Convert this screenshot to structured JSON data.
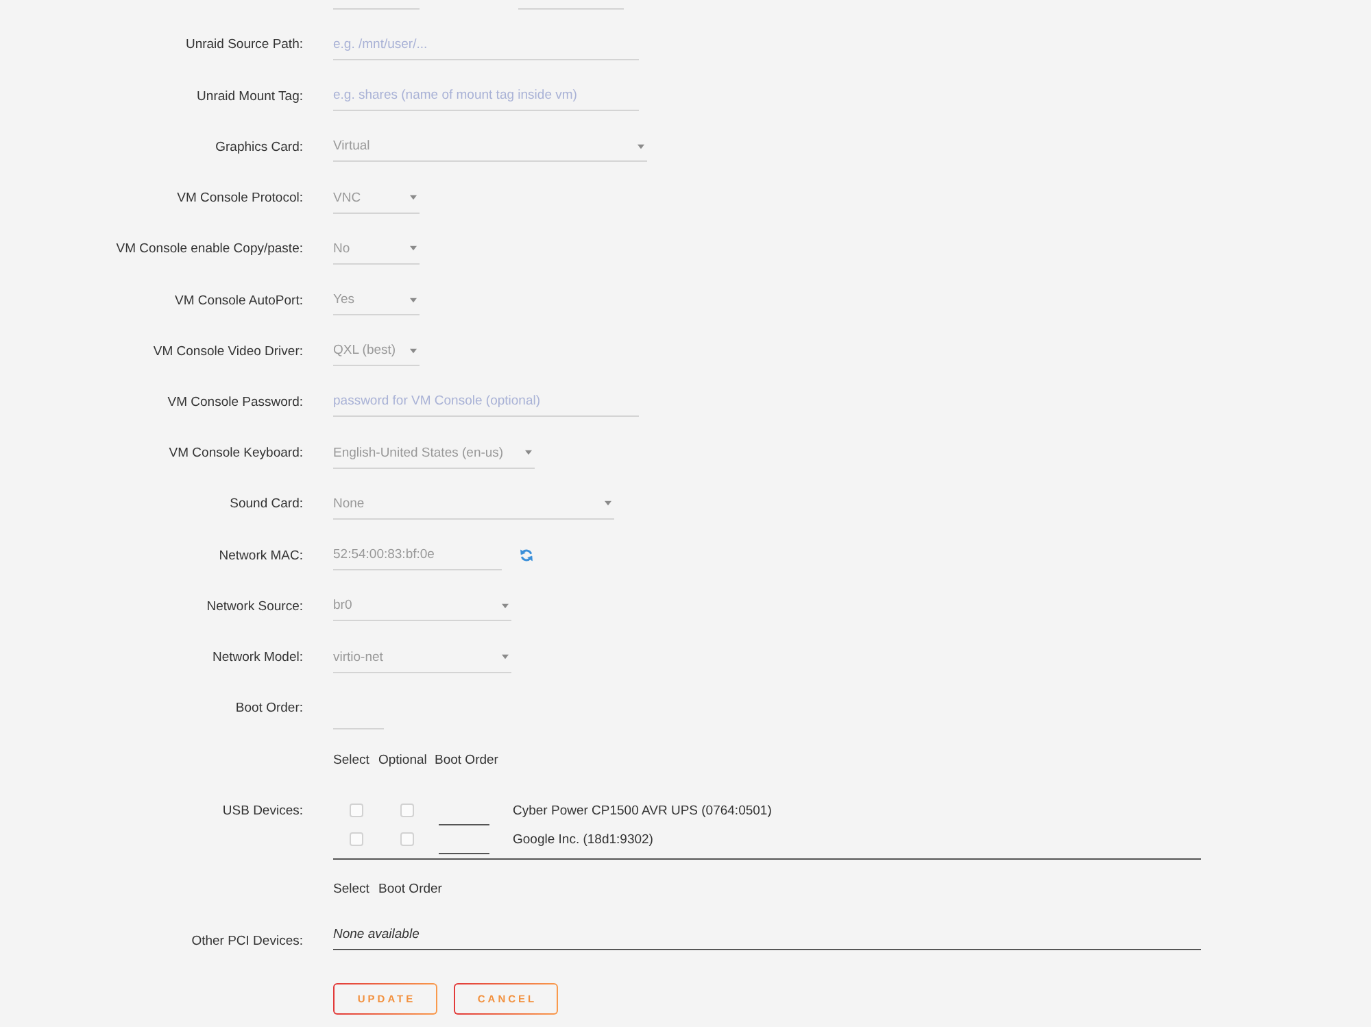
{
  "fields": [
    {
      "kind": "text",
      "label": "Unraid Source Path:",
      "placeholder": "e.g. /mnt/user/..."
    },
    {
      "kind": "text",
      "label": "Unraid Mount Tag:",
      "placeholder": "e.g. shares (name of mount tag inside vm)"
    },
    {
      "kind": "select",
      "label": "Graphics Card:",
      "value": "Virtual"
    },
    {
      "kind": "select",
      "label": "VM Console Protocol:",
      "value": "VNC"
    },
    {
      "kind": "select",
      "label": "VM Console enable Copy/paste:",
      "value": "No"
    },
    {
      "kind": "select",
      "label": "VM Console AutoPort:",
      "value": "Yes"
    },
    {
      "kind": "select",
      "label": "VM Console Video Driver:",
      "value": "QXL (best)"
    },
    {
      "kind": "text",
      "label": "VM Console Password:",
      "placeholder": "password for VM Console (optional)"
    },
    {
      "kind": "select",
      "label": "VM Console Keyboard:",
      "value": "English-United States (en-us)"
    },
    {
      "kind": "select",
      "label": "Sound Card:",
      "value": "None"
    },
    {
      "kind": "mac",
      "label": "Network MAC:",
      "value": "52:54:00:83:bf:0e"
    },
    {
      "kind": "select",
      "label": "Network Source:",
      "value": "br0"
    },
    {
      "kind": "select",
      "label": "Network Model:",
      "value": "virtio-net"
    },
    {
      "kind": "number",
      "label": "Boot Order:"
    }
  ],
  "usb_devices": {
    "label": "USB Devices:",
    "columns": [
      "Select",
      "Optional",
      "Boot Order"
    ],
    "rows": [
      {
        "name": "Cyber Power CP1500 AVR UPS (0764:0501)",
        "selected": false,
        "optional": false
      },
      {
        "name": "Google Inc. (18d1:9302)",
        "selected": false,
        "optional": false
      }
    ]
  },
  "pci_devices": {
    "label": "Other PCI Devices:",
    "columns": [
      "Select",
      "Boot Order"
    ],
    "empty_message": "None available"
  },
  "buttons": [
    "UPDATE",
    "CANCEL"
  ]
}
